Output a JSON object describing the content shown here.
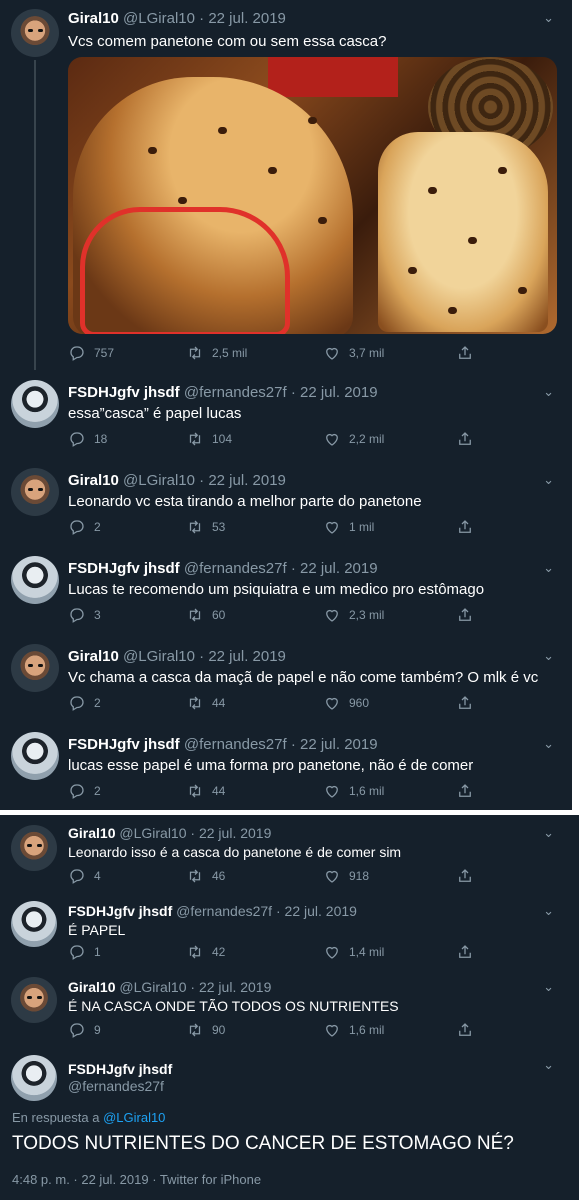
{
  "colors": {
    "background": "#15202b",
    "text": "#ffffff",
    "muted": "#8899a6",
    "link": "#1da1f2",
    "highlight": "#e0312a"
  },
  "tweets": [
    {
      "name": "Giral10",
      "handle": "@LGiral10",
      "date": "22 jul. 2019",
      "text": "Vcs comem panetone com ou sem essa casca?",
      "replies": "757",
      "retweets": "2,5 mil",
      "likes": "3,7 mil"
    },
    {
      "name": "FSDHJgfv jhsdf",
      "handle": "@fernandes27f",
      "date": "22 jul. 2019",
      "text": "essa”casca” é papel lucas",
      "replies": "18",
      "retweets": "104",
      "likes": "2,2 mil"
    },
    {
      "name": "Giral10",
      "handle": "@LGiral10",
      "date": "22 jul. 2019",
      "text": "Leonardo vc esta tirando a melhor parte do panetone",
      "replies": "2",
      "retweets": "53",
      "likes": "1 mil"
    },
    {
      "name": "FSDHJgfv jhsdf",
      "handle": "@fernandes27f",
      "date": "22 jul. 2019",
      "text": "Lucas te recomendo um psiquiatra e um medico pro estômago",
      "replies": "3",
      "retweets": "60",
      "likes": "2,3 mil"
    },
    {
      "name": "Giral10",
      "handle": "@LGiral10",
      "date": "22 jul. 2019",
      "text": "Vc chama a casca da maçã de papel e não come também? O mlk é vc",
      "replies": "2",
      "retweets": "44",
      "likes": "960"
    },
    {
      "name": "FSDHJgfv jhsdf",
      "handle": "@fernandes27f",
      "date": "22 jul. 2019",
      "text": "lucas esse papel é uma forma pro panetone, não é de comer",
      "replies": "2",
      "retweets": "44",
      "likes": "1,6 mil"
    },
    {
      "name": "Giral10",
      "handle": "@LGiral10",
      "date": "22 jul. 2019",
      "text": "Leonardo isso é a casca do panetone é de comer sim",
      "replies": "4",
      "retweets": "46",
      "likes": "918"
    },
    {
      "name": "FSDHJgfv jhsdf",
      "handle": "@fernandes27f",
      "date": "22 jul. 2019",
      "text": "É PAPEL",
      "replies": "1",
      "retweets": "42",
      "likes": "1,4 mil"
    },
    {
      "name": "Giral10",
      "handle": "@LGiral10",
      "date": "22 jul. 2019",
      "text": "É NA CASCA ONDE TÃO TODOS OS NUTRIENTES",
      "replies": "9",
      "retweets": "90",
      "likes": "1,6 mil"
    }
  ],
  "main_tweet": {
    "name": "FSDHJgfv jhsdf",
    "handle": "@fernandes27f",
    "reply_prefix": "En respuesta a",
    "reply_to": "@LGiral10",
    "text": "TODOS NUTRIENTES DO CANCER DE ESTOMAGO NÉ?",
    "footer": "4:48 p. m. · 22 jul. 2019 · Twitter for iPhone"
  },
  "icons": {
    "reply": "reply-icon",
    "retweet": "retweet-icon",
    "like": "like-icon",
    "share": "share-icon",
    "caret": "chevron-down-icon"
  }
}
